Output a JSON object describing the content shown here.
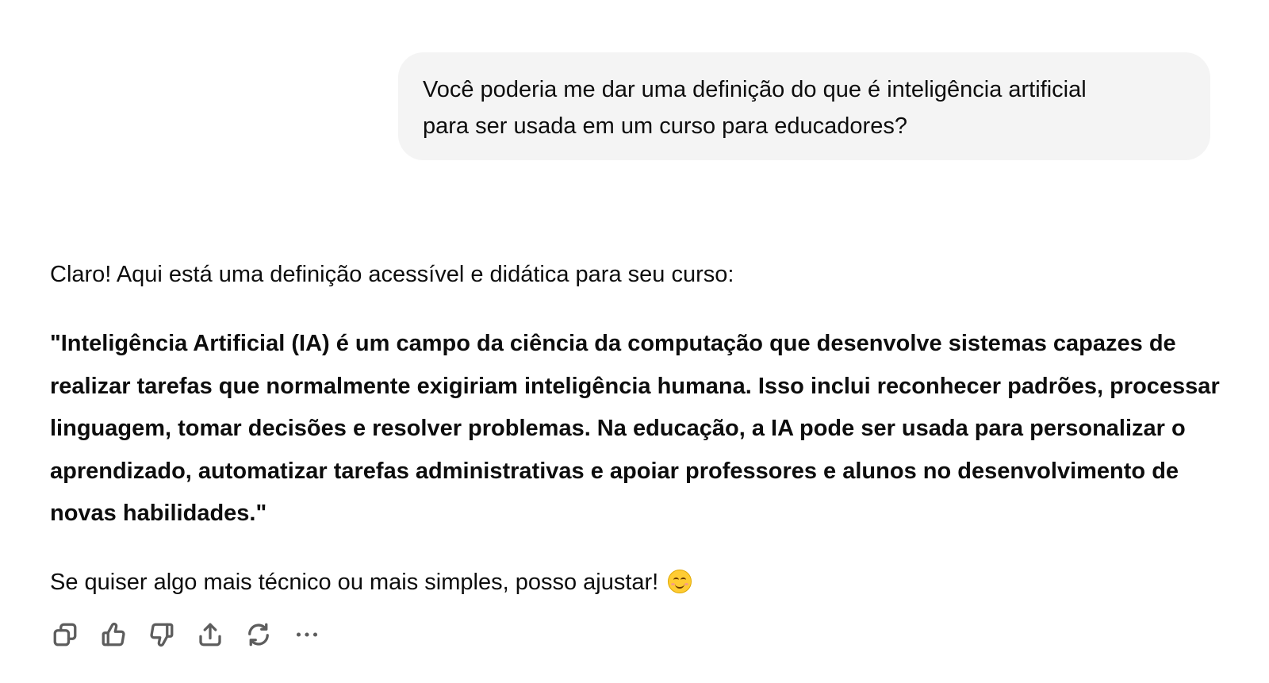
{
  "user_message": {
    "line1": "Você poderia me dar uma definição do que é inteligência artificial",
    "line2": "para ser usada em um curso para educadores?"
  },
  "assistant_message": {
    "intro": "Claro! Aqui está uma definição acessível e didática para seu curso:",
    "definition": "\"Inteligência Artificial (IA) é um campo da ciência da computação que desenvolve sistemas capazes de realizar tarefas que normalmente exigiriam inteligência humana. Isso inclui reconhecer padrões, processar linguagem, tomar decisões e resolver problemas. Na educação, a IA pode ser usada para personalizar o aprendizado, automatizar tarefas administrativas e apoiar professores e alunos no desenvolvimento de novas habilidades.\"",
    "outro": "Se quiser algo mais técnico ou mais simples, posso ajustar!",
    "outro_emoji": "smiling-face-emoji"
  },
  "actions": [
    {
      "name": "copy",
      "icon": "copy-icon"
    },
    {
      "name": "thumbs-up",
      "icon": "thumbs-up-icon"
    },
    {
      "name": "thumbs-down",
      "icon": "thumbs-down-icon"
    },
    {
      "name": "share",
      "icon": "share-icon"
    },
    {
      "name": "regenerate",
      "icon": "regenerate-icon"
    },
    {
      "name": "more",
      "icon": "more-icon"
    }
  ],
  "colors": {
    "user_bubble_bg": "#f4f4f4",
    "text": "#0d0d0d",
    "icon": "#5d5d5d"
  }
}
